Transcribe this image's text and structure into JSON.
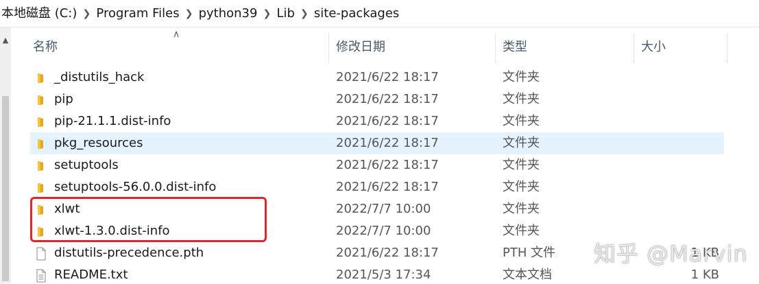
{
  "breadcrumb": [
    "本地磁盘 (C:)",
    "Program Files",
    "python39",
    "Lib",
    "site-packages"
  ],
  "columns": {
    "name": "名称",
    "date": "修改日期",
    "type": "类型",
    "size": "大小"
  },
  "files": [
    {
      "name": "_distutils_hack",
      "date": "2021/6/22 18:17",
      "type": "文件夹",
      "size": "",
      "icon": "folder-icon"
    },
    {
      "name": "pip",
      "date": "2021/6/22 18:17",
      "type": "文件夹",
      "size": "",
      "icon": "folder-icon"
    },
    {
      "name": "pip-21.1.1.dist-info",
      "date": "2021/6/22 18:17",
      "type": "文件夹",
      "size": "",
      "icon": "folder-icon"
    },
    {
      "name": "pkg_resources",
      "date": "2021/6/22 18:17",
      "type": "文件夹",
      "size": "",
      "icon": "folder-icon"
    },
    {
      "name": "setuptools",
      "date": "2021/6/22 18:17",
      "type": "文件夹",
      "size": "",
      "icon": "folder-icon"
    },
    {
      "name": "setuptools-56.0.0.dist-info",
      "date": "2021/6/22 18:17",
      "type": "文件夹",
      "size": "",
      "icon": "folder-icon"
    },
    {
      "name": "xlwt",
      "date": "2022/7/7 10:00",
      "type": "文件夹",
      "size": "",
      "icon": "folder-icon"
    },
    {
      "name": "xlwt-1.3.0.dist-info",
      "date": "2022/7/7 10:00",
      "type": "文件夹",
      "size": "",
      "icon": "folder-icon"
    },
    {
      "name": "distutils-precedence.pth",
      "date": "2021/6/22 18:17",
      "type": "PTH 文件",
      "size": "1 KB",
      "icon": "file-icon"
    },
    {
      "name": "README.txt",
      "date": "2021/5/3 17:34",
      "type": "文本文档",
      "size": "1 KB",
      "icon": "text-file-icon"
    }
  ],
  "selected_row": "pkg_resources",
  "watermark": "知乎 @Marvin",
  "colors": {
    "folder": "#f2c53d",
    "selection": "#e5f3ff",
    "highlight": "#e3242b"
  }
}
